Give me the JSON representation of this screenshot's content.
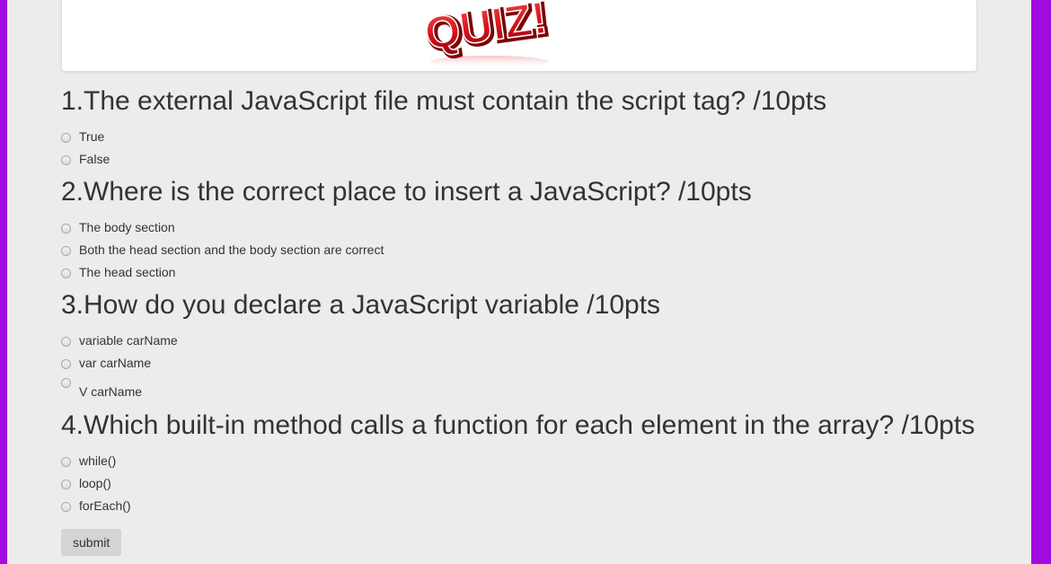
{
  "header": {
    "logo_text": "QUIZ!"
  },
  "questions": [
    {
      "title": "1.The external JavaScript file must contain the script tag? /10pts",
      "options": [
        "True",
        "False"
      ]
    },
    {
      "title": "2.Where is the correct place to insert a JavaScript? /10pts",
      "options": [
        "The body section",
        "Both the head section and the body section are correct",
        "The head section"
      ]
    },
    {
      "title": "3.How do you declare a JavaScript variable /10pts",
      "options": [
        "variable carName",
        "var carName",
        "V carName"
      ]
    },
    {
      "title": "4.Which built-in method calls a function for each element in the array? /10pts",
      "options": [
        "while()",
        "loop()",
        "forEach()"
      ]
    }
  ],
  "actions": {
    "submit_label": "submit"
  },
  "colors": {
    "frame": "#a10ce0",
    "background": "#ececec",
    "logo_red": "#d8101c"
  }
}
